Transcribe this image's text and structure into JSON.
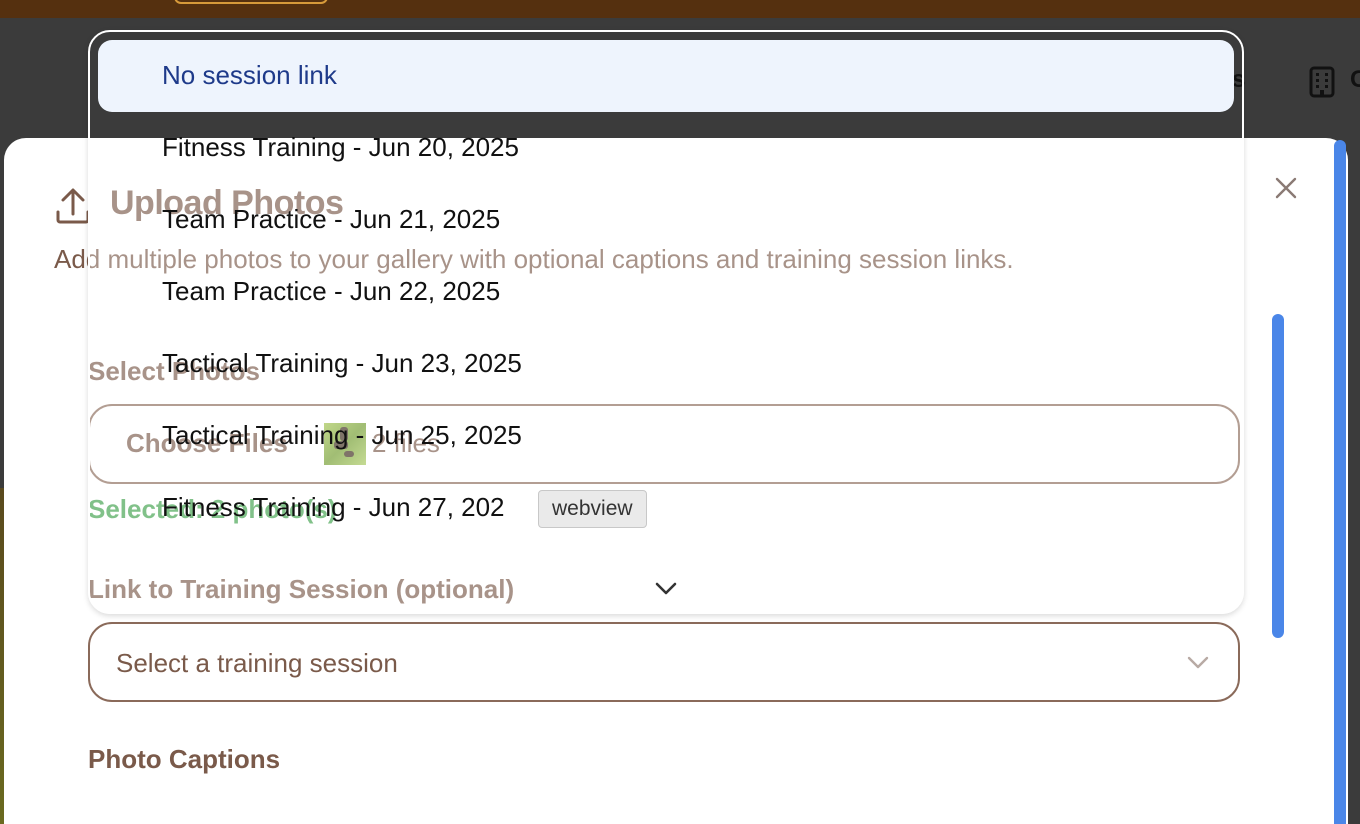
{
  "background": {
    "header_fragment_s": "s",
    "header_fragment_c": "C",
    "building_icon": "building-icon"
  },
  "dialog": {
    "title": "Upload Photos",
    "description": "Add multiple photos to your gallery with optional captions and training session links.",
    "close_icon": "close-icon",
    "upload_icon": "upload-icon",
    "select_photos": {
      "label": "Select Photos",
      "choose_files_label": "Choose Files",
      "file_count": "2 files",
      "status": "Selected: 2 photo(s)"
    },
    "session_link": {
      "label": "Link to Training Session (optional)",
      "placeholder": "Select a training session"
    },
    "captions": {
      "label": "Photo Captions"
    }
  },
  "dropdown": {
    "options": [
      {
        "label": "No session link",
        "selected": true
      },
      {
        "label": "Fitness Training - Jun 20, 2025",
        "selected": false
      },
      {
        "label": "Team Practice - Jun 21, 2025",
        "selected": false
      },
      {
        "label": "Team Practice - Jun 22, 2025",
        "selected": false
      },
      {
        "label": "Tactical Training - Jun 23, 2025",
        "selected": false
      },
      {
        "label": "Tactical Training - Jun 25, 2025",
        "selected": false
      },
      {
        "label": "Fitness Training - Jun 27, 202",
        "selected": false
      }
    ]
  },
  "tooltip": {
    "text": "webview"
  },
  "colors": {
    "topbar": "#55300f",
    "text_brown": "#7a5a4a",
    "success_green": "#3ea04a",
    "selected_option": "#1e3a8a",
    "highlight": "#eef4fd",
    "scrollbar": "#4a86e8"
  }
}
